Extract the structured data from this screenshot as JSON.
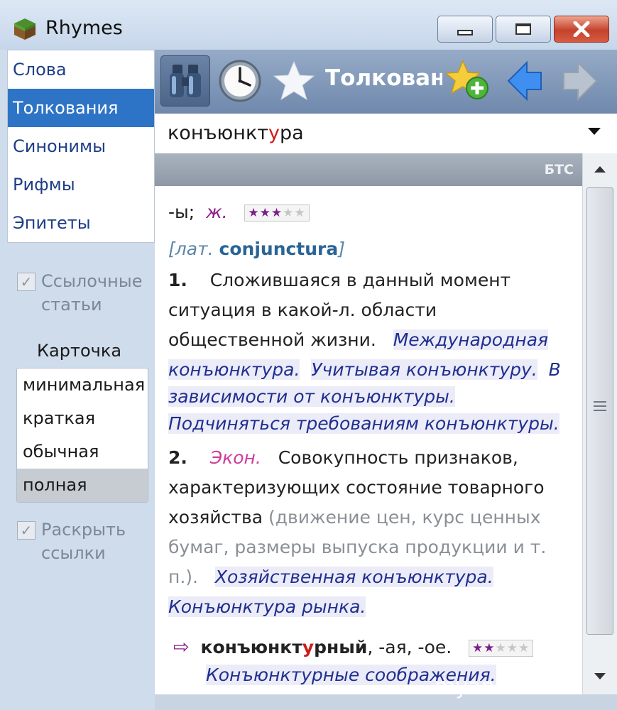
{
  "window": {
    "title": "Rhymes"
  },
  "sidebar": {
    "items": [
      {
        "label": "Слова"
      },
      {
        "label": "Толкования"
      },
      {
        "label": "Синонимы"
      },
      {
        "label": "Рифмы"
      },
      {
        "label": "Эпитеты"
      }
    ],
    "active": "Толкования",
    "ref_articles": {
      "line1": "Ссылочные",
      "line2": "статьи",
      "checked": true
    },
    "card": {
      "label": "Карточка",
      "options": [
        "минимальная",
        "краткая",
        "обычная",
        "полная"
      ],
      "selected": "полная"
    },
    "expand_links": {
      "line1": "Раскрыть",
      "line2": "ссылки",
      "checked": true
    }
  },
  "toolbar": {
    "title": "Толкования",
    "icons": [
      "binoculars-icon",
      "clock-icon",
      "star-icon",
      "add-favorite-icon",
      "back-arrow-icon",
      "forward-arrow-icon"
    ]
  },
  "search": {
    "value_pre": "конъюнкт",
    "value_stress": "у",
    "value_post": "ра"
  },
  "source": {
    "label": "БТС"
  },
  "entry": {
    "gram_ending": "-ы;",
    "gender": "ж.",
    "rating": {
      "filled": 3,
      "total": 5
    },
    "etym_lang": "лат.",
    "etym_word": "conjunctura",
    "sense1_num": "1.",
    "sense1_l1": "Сложившаяся в данный момент",
    "sense1_l2": "ситуация в какой-л. области",
    "sense1_l3": "общественной жизни.",
    "ex1": "Международная",
    "ex2": "конъюнктура.",
    "ex3": "Учитывая конъюнктуру.",
    "ex4": "В",
    "ex5": "зависимости от конъюнктуры.",
    "ex6": "Подчиняться требованиям конъюнктуры.",
    "sense2_num": "2.",
    "sense2_label": "Экон.",
    "sense2_l1": "Совокупность признаков,",
    "sense2_l2": "характеризующих состояние товарного",
    "sense2_l3": "хозяйства",
    "sense2_g1": "(движение цен, курс ценных",
    "sense2_g2": "бумаг, размеры выпуска продукции и т.",
    "sense2_g3": "п.).",
    "ex7": "Хозяйственная конъюнктура.",
    "ex8": "Конъюнктура рынка.",
    "deriv_arrow": "⇨",
    "deriv_pre": "конъюнкт",
    "deriv_stress": "у",
    "deriv_post": "рный",
    "deriv_endings": ", -ая, -ое.",
    "deriv_rating": {
      "filled": 2,
      "total": 5
    },
    "deriv_ex": "Конъюнктурные соображения."
  },
  "watermark": "myanswer.ru"
}
